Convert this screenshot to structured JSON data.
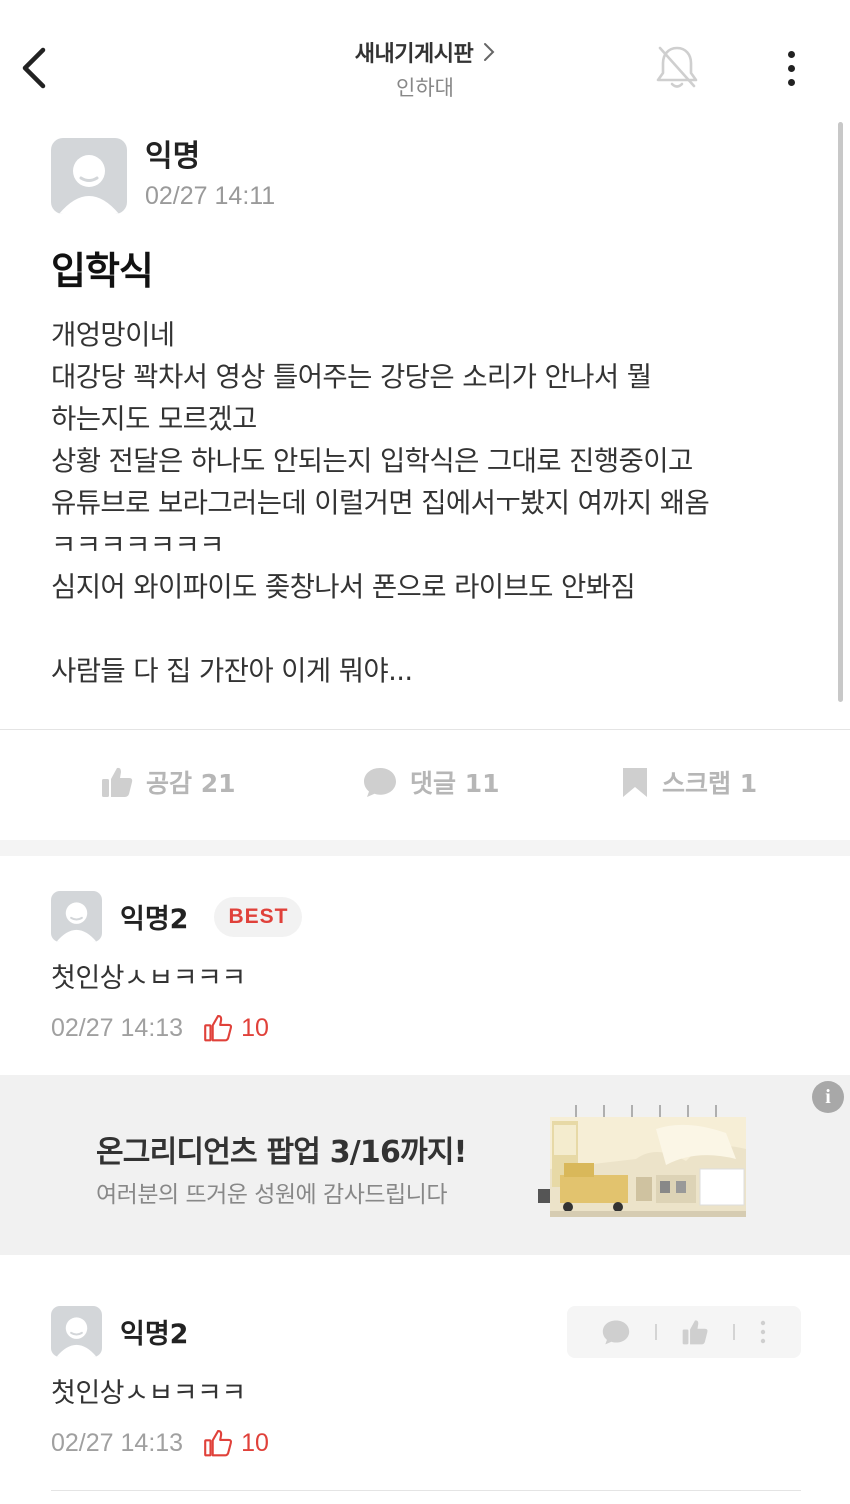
{
  "header": {
    "board_title": "새내기게시판",
    "board_subtitle": "인하대"
  },
  "post": {
    "author": "익명",
    "date": "02/27 14:11",
    "title": "입학식",
    "body_lines": [
      "개엉망이네",
      "대강당 꽉차서 영상 틀어주는 강당은 소리가 안나서 뭘",
      "하는지도 모르겠고",
      "상황 전달은 하나도 안되는지 입학식은 그대로 진행중이고",
      "유튜브로 보라그러는데 이럴거면 집에서ㅜ봤지 여까지 왜옴",
      "ㅋㅋㅋㅋㅋㅋㅋ",
      "심지어 와이파이도 좆창나서 폰으로 라이브도 안봐짐",
      "",
      "사람들 다 집 가잔아 이게 뭐야..."
    ],
    "actions": {
      "like": "공감 21",
      "comment": "댓글 11",
      "scrap": "스크랩 1"
    }
  },
  "best_comment": {
    "author": "익명2",
    "badge": "BEST",
    "text": "첫인상ㅅㅂㅋㅋㅋ",
    "date": "02/27 14:13",
    "likes": "10"
  },
  "ad": {
    "title": "온그리디언츠 팝업 3/16까지!",
    "subtitle": "여러분의 뜨거운 성원에 감사드립니다",
    "info_icon": "i"
  },
  "comment": {
    "author": "익명2",
    "text": "첫인상ㅅㅂㅋㅋㅋ",
    "date": "02/27 14:13",
    "likes": "10"
  },
  "colors": {
    "accent_red": "#e0413a",
    "muted_gray": "#b6b6b6"
  }
}
